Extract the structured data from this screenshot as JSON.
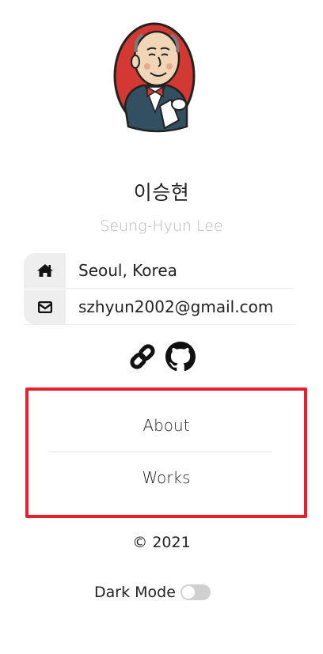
{
  "profile": {
    "avatar_icon": "jenkins-butler-avatar",
    "name_ko": "이승현",
    "name_en": "Seung-Hyun Lee"
  },
  "info": [
    {
      "icon": "home-icon",
      "text": "Seoul, Korea"
    },
    {
      "icon": "envelope-icon",
      "text": "szhyun2002@gmail.com"
    }
  ],
  "links": [
    {
      "icon": "link-icon"
    },
    {
      "icon": "github-icon"
    }
  ],
  "nav": {
    "items": [
      {
        "label": "About"
      },
      {
        "label": "Works"
      }
    ],
    "highlight_color": "#e8202e"
  },
  "footer": {
    "copyright": "© 2021",
    "dark_mode_label": "Dark Mode",
    "dark_mode_on": false
  }
}
